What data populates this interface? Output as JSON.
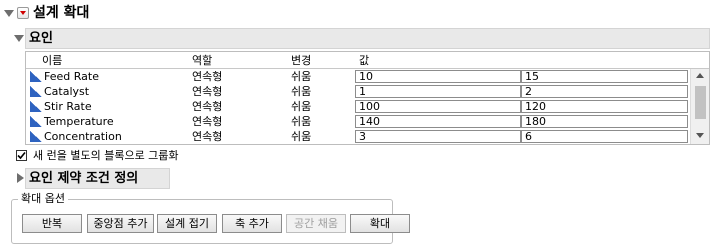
{
  "design_section": {
    "title": "설계 확대"
  },
  "factors_section": {
    "title": "요인",
    "columns": [
      "이름",
      "역할",
      "변경",
      "값"
    ],
    "rows": [
      {
        "name": "Feed Rate",
        "role": "연속형",
        "change": "쉬움",
        "low": "10",
        "high": "15"
      },
      {
        "name": "Catalyst",
        "role": "연속형",
        "change": "쉬움",
        "low": "1",
        "high": "2"
      },
      {
        "name": "Stir Rate",
        "role": "연속형",
        "change": "쉬움",
        "low": "100",
        "high": "120"
      },
      {
        "name": "Temperature",
        "role": "연속형",
        "change": "쉬움",
        "low": "140",
        "high": "180"
      },
      {
        "name": "Concentration",
        "role": "연속형",
        "change": "쉬움",
        "low": "3",
        "high": "6"
      }
    ]
  },
  "group_checkbox": {
    "label": "새 런을 별도의 블록으로 그룹화",
    "checked": true
  },
  "constraints_section": {
    "title": "요인 제약 조건 정의"
  },
  "augment_options": {
    "title": "확대 옵션",
    "buttons": {
      "replicate": "반복",
      "add_centerpoints": "중앙점 추가",
      "fold_over": "설계 접기",
      "add_axial": "축 추가",
      "space_filling": "공간 채움",
      "augment": "확대"
    }
  }
}
